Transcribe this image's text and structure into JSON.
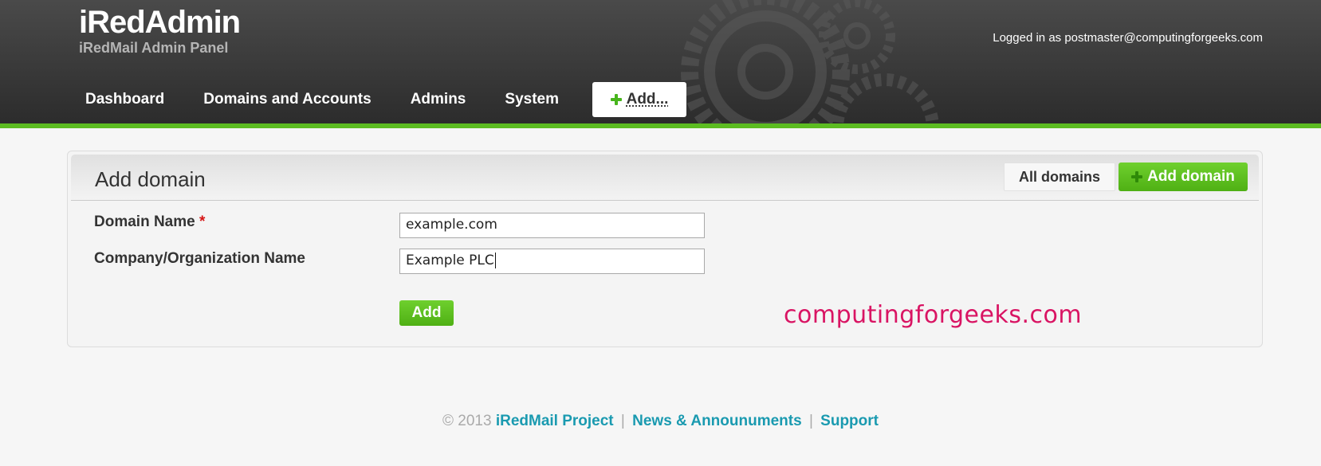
{
  "header": {
    "title": "iRedAdmin",
    "subtitle": "iRedMail Admin Panel",
    "logged_in": "Logged in as postmaster@computingforgeeks.com"
  },
  "nav": {
    "items": [
      "Dashboard",
      "Domains and Accounts",
      "Admins",
      "System"
    ],
    "add_label": "Add..."
  },
  "panel": {
    "title": "Add domain",
    "all_domains": "All domains",
    "add_domain": "Add domain"
  },
  "form": {
    "domain_label": "Domain Name",
    "required_mark": "*",
    "domain_value": "example.com",
    "company_label": "Company/Organization Name",
    "company_value": "Example PLC",
    "submit_label": "Add"
  },
  "watermark": "computingforgeeks.com",
  "footer": {
    "copyright": "© 2013",
    "project": "iRedMail Project",
    "news": "News & Announuments",
    "support": "Support",
    "separator": "|"
  },
  "colors": {
    "accent_green": "#5cbc21",
    "link": "#1a9ab0",
    "watermark": "#d91463"
  }
}
